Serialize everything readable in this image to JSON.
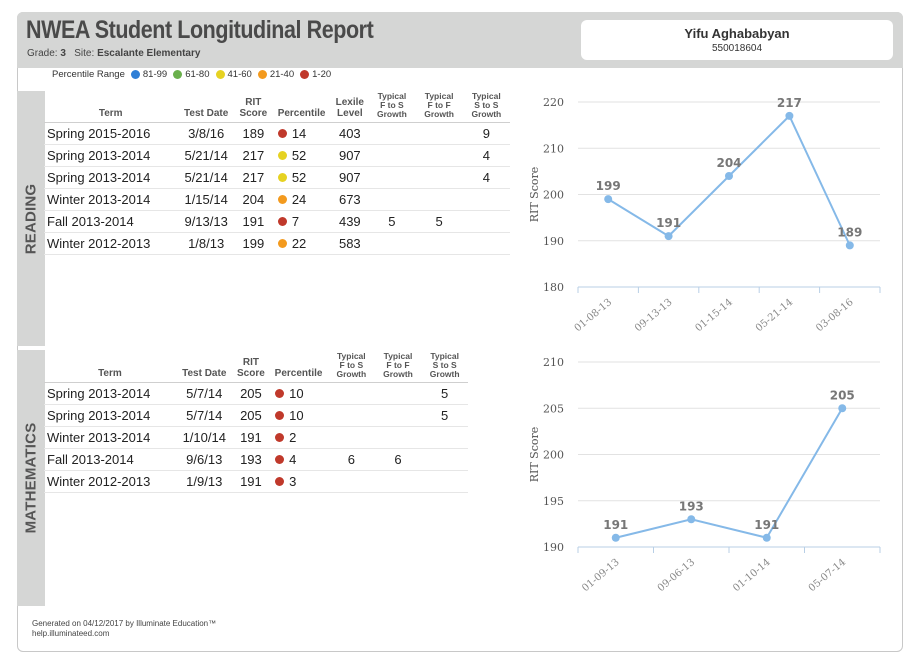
{
  "header": {
    "title": "NWEA Student Longitudinal Report",
    "grade_label": "Grade:",
    "grade_value": "3",
    "site_label": "Site:",
    "site_value": "Escalante Elementary"
  },
  "student": {
    "name": "Yifu Aghababyan",
    "id": "550018604"
  },
  "legend": {
    "label": "Percentile Range",
    "ranges": [
      {
        "label": "81-99",
        "color": "#2f7fd6"
      },
      {
        "label": "61-80",
        "color": "#6ab04c"
      },
      {
        "label": "41-60",
        "color": "#e6d222"
      },
      {
        "label": "21-40",
        "color": "#f39a1e"
      },
      {
        "label": "1-20",
        "color": "#c0392b"
      }
    ]
  },
  "reading": {
    "tab_label": "READING",
    "columns": {
      "term": "Term",
      "test_date": "Test Date",
      "rit1": "RIT",
      "rit2": "Score",
      "percentile": "Percentile",
      "lexile1": "Lexile",
      "lexile2": "Level",
      "fs1": "Typical",
      "fs2": "F to S",
      "fs3": "Growth",
      "ff1": "Typical",
      "ff2": "F to F",
      "ff3": "Growth",
      "ss1": "Typical",
      "ss2": "S to S",
      "ss3": "Growth"
    },
    "rows": [
      {
        "term": "Spring 2015-2016",
        "date": "3/8/16",
        "rit": "189",
        "pct": "14",
        "color": "#c0392b",
        "lexile": "403",
        "fs": "",
        "ff": "",
        "ss": "9"
      },
      {
        "term": "Spring 2013-2014",
        "date": "5/21/14",
        "rit": "217",
        "pct": "52",
        "color": "#e6d222",
        "lexile": "907",
        "fs": "",
        "ff": "",
        "ss": "4"
      },
      {
        "term": "Spring 2013-2014",
        "date": "5/21/14",
        "rit": "217",
        "pct": "52",
        "color": "#e6d222",
        "lexile": "907",
        "fs": "",
        "ff": "",
        "ss": "4"
      },
      {
        "term": "Winter 2013-2014",
        "date": "1/15/14",
        "rit": "204",
        "pct": "24",
        "color": "#f39a1e",
        "lexile": "673",
        "fs": "",
        "ff": "",
        "ss": ""
      },
      {
        "term": "Fall 2013-2014",
        "date": "9/13/13",
        "rit": "191",
        "pct": "7",
        "color": "#c0392b",
        "lexile": "439",
        "fs": "5",
        "ff": "5",
        "ss": ""
      },
      {
        "term": "Winter 2012-2013",
        "date": "1/8/13",
        "rit": "199",
        "pct": "22",
        "color": "#f39a1e",
        "lexile": "583",
        "fs": "",
        "ff": "",
        "ss": ""
      }
    ]
  },
  "math": {
    "tab_label": "MATHEMATICS",
    "columns": {
      "term": "Term",
      "test_date": "Test Date",
      "rit1": "RIT",
      "rit2": "Score",
      "percentile": "Percentile",
      "fs1": "Typical",
      "fs2": "F to S",
      "fs3": "Growth",
      "ff1": "Typical",
      "ff2": "F to F",
      "ff3": "Growth",
      "ss1": "Typical",
      "ss2": "S to S",
      "ss3": "Growth"
    },
    "rows": [
      {
        "term": "Spring 2013-2014",
        "date": "5/7/14",
        "rit": "205",
        "pct": "10",
        "color": "#c0392b",
        "fs": "",
        "ff": "",
        "ss": "5"
      },
      {
        "term": "Spring 2013-2014",
        "date": "5/7/14",
        "rit": "205",
        "pct": "10",
        "color": "#c0392b",
        "fs": "",
        "ff": "",
        "ss": "5"
      },
      {
        "term": "Winter 2013-2014",
        "date": "1/10/14",
        "rit": "191",
        "pct": "2",
        "color": "#c0392b",
        "fs": "",
        "ff": "",
        "ss": ""
      },
      {
        "term": "Fall 2013-2014",
        "date": "9/6/13",
        "rit": "193",
        "pct": "4",
        "color": "#c0392b",
        "fs": "6",
        "ff": "6",
        "ss": ""
      },
      {
        "term": "Winter 2012-2013",
        "date": "1/9/13",
        "rit": "191",
        "pct": "3",
        "color": "#c0392b",
        "fs": "",
        "ff": "",
        "ss": ""
      }
    ]
  },
  "chart_data": [
    {
      "type": "line",
      "ylabel": "RIT Score",
      "categories": [
        "01-08-13",
        "09-13-13",
        "01-15-14",
        "05-21-14",
        "03-08-16"
      ],
      "values": [
        199,
        191,
        204,
        217,
        189
      ],
      "ylim": [
        180,
        220
      ],
      "yticks": [
        180,
        190,
        200,
        210,
        220
      ],
      "grid": true,
      "line_color": "#85b9e8"
    },
    {
      "type": "line",
      "ylabel": "RIT Score",
      "categories": [
        "01-09-13",
        "09-06-13",
        "01-10-14",
        "05-07-14"
      ],
      "values": [
        191,
        193,
        191,
        205
      ],
      "ylim": [
        190,
        210
      ],
      "yticks": [
        190,
        195,
        200,
        205,
        210
      ],
      "grid": true,
      "line_color": "#85b9e8"
    }
  ],
  "footer": {
    "line1": "Generated on 04/12/2017 by Illuminate Education™",
    "line2": "help.illuminateed.com"
  }
}
